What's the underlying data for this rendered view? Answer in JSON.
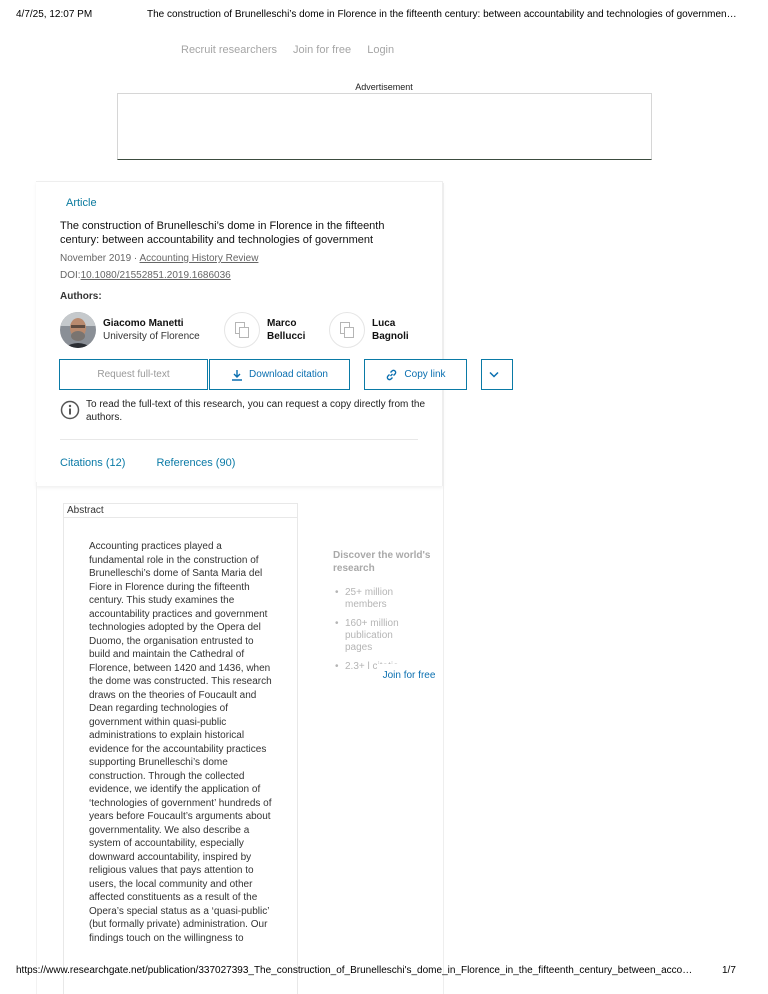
{
  "print_header": {
    "date": "4/7/25, 12:07 PM",
    "doc_title": "The construction of Brunelleschi’s dome in Florence in the fifteenth century: between accountability and technologies of governmen…"
  },
  "nav": {
    "recruit": "Recruit researchers",
    "join": "Join for free",
    "login": "Login"
  },
  "ad": {
    "label": "Advertisement"
  },
  "article": {
    "type": "Article",
    "title": "The construction of Brunelleschi’s dome in Florence in the fifteenth century: between accountability and technologies of government",
    "date": "November 2019 · ",
    "journal": "Accounting History Review",
    "doi_prefix": "DOI:",
    "doi": "10.1080/21552851.2019.1686036",
    "authors_label": "Authors:",
    "authors": [
      {
        "name": "Giacomo Manetti",
        "affiliation": "University of Florence",
        "icon": "author-photo"
      },
      {
        "name": "Marco Bellucci",
        "affiliation": "",
        "icon": "profile-placeholder-icon"
      },
      {
        "name": "Luca Bagnoli",
        "affiliation": "",
        "icon": "profile-placeholder-icon"
      }
    ]
  },
  "actions": {
    "request": "Request full-text",
    "download": "Download citation",
    "copy": "Copy link",
    "more_icon": "chevron-down-icon"
  },
  "notice": {
    "icon": "info-icon",
    "text": "To read the full-text of this research, you can request a copy directly from the authors."
  },
  "tabs": {
    "citations": "Citations (12)",
    "references": "References (90)"
  },
  "abstract": {
    "header": "Abstract",
    "text": "Accounting practices played a fundamental role in the construction of Brunelleschi’s dome of Santa Maria del Fiore in Florence during the fifteenth century. This study examines the accountability practices and government technologies adopted by the Opera del Duomo, the organisation entrusted to build and maintain the Cathedral of Florence, between 1420 and 1436, when the dome was constructed. This research draws on the theories of Foucault and Dean regarding technologies of government within quasi-public administrations to explain historical evidence for the accountability practices supporting Brunelleschi’s dome construction. Through the collected evidence, we identify the application of ‘technologies of government’ hundreds of years before Foucault’s arguments about governmentality. We also describe a system of accountability, especially downward accountability, inspired by religious values that pays attention to users, the local community and other affected constituents as a result of the Opera’s special status as a ‘quasi-public’ (but formally private) administration. Our findings touch on the willingness to"
  },
  "discover": {
    "title": "Discover the world's research",
    "items": [
      "25+ million members",
      "160+ million publication pages",
      "2.3+ l citatic"
    ],
    "join": "Join for free"
  },
  "print_footer": {
    "url": "https://www.researchgate.net/publication/337027393_The_construction_of_Brunelleschi's_dome_in_Florence_in_the_fifteenth_century_between_acco…",
    "page": "1/7"
  }
}
